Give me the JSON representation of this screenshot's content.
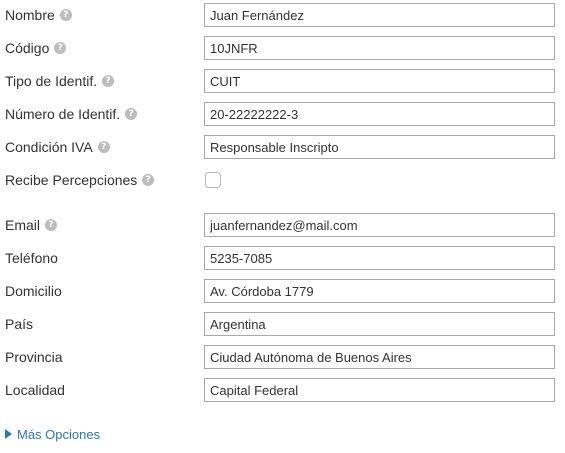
{
  "form": {
    "nombre": {
      "label": "Nombre",
      "value": "Juan Fernández"
    },
    "codigo": {
      "label": "Código",
      "value": "10JNFR"
    },
    "tipo_identif": {
      "label": "Tipo de Identif.",
      "value": "CUIT"
    },
    "numero_identif": {
      "label": "Número de Identif.",
      "value": "20-22222222-3"
    },
    "condicion_iva": {
      "label": "Condición IVA",
      "value": "Responsable Inscripto"
    },
    "recibe_percepciones": {
      "label": "Recibe Percepciones",
      "checked": false
    },
    "email": {
      "label": "Email",
      "value": "juanfernandez@mail.com"
    },
    "telefono": {
      "label": "Teléfono",
      "value": "5235-7085"
    },
    "domicilio": {
      "label": "Domicilio",
      "value": "Av. Córdoba 1779"
    },
    "pais": {
      "label": "País",
      "value": "Argentina"
    },
    "provincia": {
      "label": "Provincia",
      "value": "Ciudad Autónoma de Buenos Aires"
    },
    "localidad": {
      "label": "Localidad",
      "value": "Capital Federal"
    }
  },
  "more_options": {
    "label": "Más Opciones"
  },
  "icons": {
    "help": "help-icon",
    "expand": "triangle-right-icon"
  },
  "colors": {
    "link": "#2a7ab0",
    "help_icon": "#bdbdbd",
    "input_border": "#a9a9a9"
  }
}
